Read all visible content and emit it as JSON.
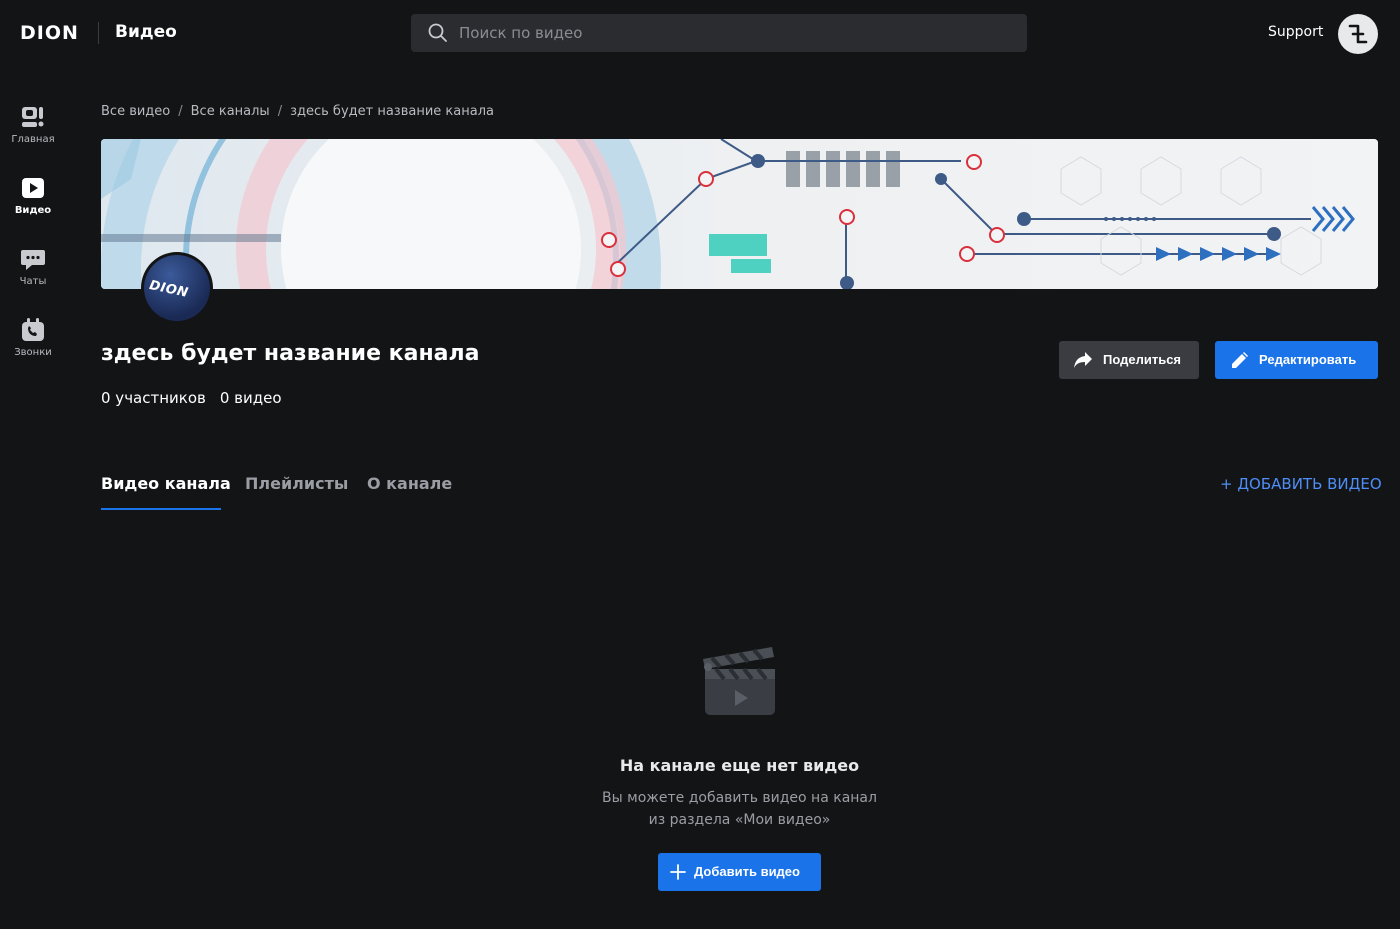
{
  "header": {
    "logo": "DION",
    "app_title": "Видео",
    "search_placeholder": "Поиск по видео",
    "support_label": "Support"
  },
  "sidebar": {
    "items": [
      {
        "label": "Главная",
        "icon": "home-icon"
      },
      {
        "label": "Видео",
        "icon": "video-icon",
        "active": true
      },
      {
        "label": "Чаты",
        "icon": "chat-icon"
      },
      {
        "label": "Звонки",
        "icon": "calls-icon"
      }
    ]
  },
  "breadcrumb": [
    "Все видео",
    "Все каналы",
    "здесь будет название канала"
  ],
  "channel": {
    "avatar_text": "DION",
    "title": "здесь будет название канала",
    "members": "0 участников",
    "videos": "0 видео",
    "share_label": "Поделиться",
    "edit_label": "Редактировать"
  },
  "tabs": [
    {
      "label": "Видео канала",
      "active": true
    },
    {
      "label": "Плейлисты"
    },
    {
      "label": "О канале"
    }
  ],
  "add_video_link": "+ ДОБАВИТЬ ВИДЕО",
  "empty_state": {
    "title": "На канале еще нет видео",
    "line1": "Вы можете добавить видео на канал",
    "line2": "из раздела «Мои видео»",
    "button_label": "Добавить видео"
  },
  "colors": {
    "background": "#131416",
    "accent": "#1a73e8",
    "link": "#4f8ef7"
  }
}
